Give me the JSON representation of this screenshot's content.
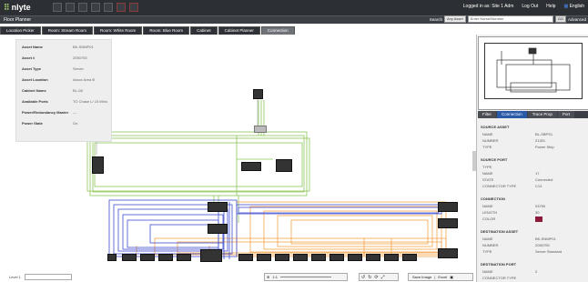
{
  "app": {
    "logo": "nlyte",
    "page_title": "Floor Planner"
  },
  "topbar": {
    "logged_in": "Logged in as: Site 1 Adm",
    "logout": "Log Out",
    "help": "Help",
    "language": "English"
  },
  "search": {
    "label": "Search",
    "scope": "Any Asset",
    "placeholder": "Enter Name/Number",
    "go": "GO",
    "advanced": "Advanced"
  },
  "tabs": [
    {
      "label": "Location Picker"
    },
    {
      "label": "Room: Stream Room"
    },
    {
      "label": "Room: White Room"
    },
    {
      "label": "Room: Blue Room"
    },
    {
      "label": "Cabinet"
    },
    {
      "label": "Cabinet Planner"
    },
    {
      "label": "Connection"
    }
  ],
  "asset_info": [
    {
      "key": "Asset Name",
      "value": "BK-SNMP01"
    },
    {
      "key": "Asset #",
      "value": "2050705"
    },
    {
      "key": "Asset Type",
      "value": "Server"
    },
    {
      "key": "Asset Location",
      "value": "Assoc Area B"
    },
    {
      "key": "Cabinet Name",
      "value": "BL-08"
    },
    {
      "key": "Available Ports",
      "value": "TO Chase L/ 10 Mb/s"
    },
    {
      "key": "Power/Redundancy Master",
      "value": "---"
    },
    {
      "key": "Power State",
      "value": "On"
    }
  ],
  "right_panel": {
    "tabs": [
      "Filter",
      "Connection",
      "Trace Prop",
      "Port"
    ],
    "active_tab": "Connection",
    "sections": [
      {
        "title": "SOURCE ASSET",
        "rows": [
          {
            "k": "NAME",
            "v": "BL-SBPS1"
          },
          {
            "k": "NUMBER",
            "v": "21301"
          },
          {
            "k": "TYPE",
            "v": "Power Strip"
          }
        ]
      },
      {
        "title": "SOURCE PORT",
        "rows": [
          {
            "k": "TYPE",
            "v": ""
          },
          {
            "k": "NAME",
            "v": "17"
          },
          {
            "k": "STATE",
            "v": "Connected"
          },
          {
            "k": "CONNECTOR TYPE",
            "v": "C13"
          }
        ]
      },
      {
        "title": "CONNECTION",
        "rows": [
          {
            "k": "NAME",
            "v": "03750"
          },
          {
            "k": "LENGTH",
            "v": "30"
          },
          {
            "k": "COLOR",
            "v": ""
          }
        ]
      },
      {
        "title": "DESTINATION ASSET",
        "rows": [
          {
            "k": "NAME",
            "v": "BK-SNMP01"
          },
          {
            "k": "NUMBER",
            "v": "2050705"
          },
          {
            "k": "TYPE",
            "v": "Server Standard"
          }
        ]
      },
      {
        "title": "DESTINATION PORT",
        "rows": [
          {
            "k": "NAME",
            "v": "2"
          },
          {
            "k": "CONNECTOR TYPE",
            "v": ""
          }
        ]
      }
    ],
    "connection_color": "#8b1a3a"
  },
  "bottom": {
    "level_label": "Level 1",
    "zoom_label": "1:1",
    "save_image": "Save Image",
    "excel": "Excel"
  },
  "colors": {
    "green": "#8cc65a",
    "orange": "#f5a24a",
    "blue": "#3f4fd0"
  }
}
